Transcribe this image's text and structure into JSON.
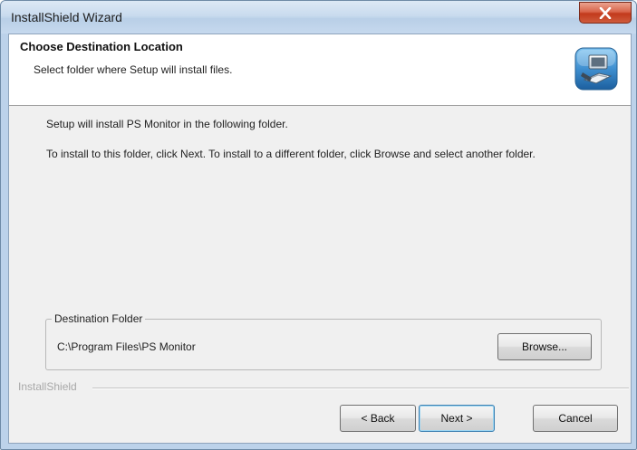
{
  "window": {
    "title": "InstallShield Wizard",
    "close_icon": "close-icon"
  },
  "header": {
    "title": "Choose Destination Location",
    "subtitle": "Select folder where Setup will install files.",
    "icon": "computer-install-icon"
  },
  "body": {
    "line1": "Setup will install PS Monitor in the following folder.",
    "line2": "To install to this folder, click Next. To install to a different folder, click Browse and select another folder."
  },
  "destination": {
    "group_label": "Destination Folder",
    "path": "C:\\Program Files\\PS Monitor",
    "browse_label": "Browse..."
  },
  "footer": {
    "brand": "InstallShield",
    "back_label": "< Back",
    "next_label": "Next >",
    "cancel_label": "Cancel"
  },
  "colors": {
    "titlebar": "#c9dbee",
    "client_bg": "#f0f0f0",
    "close_button": "#c23a1c",
    "default_button_border": "#3c7fb1"
  }
}
